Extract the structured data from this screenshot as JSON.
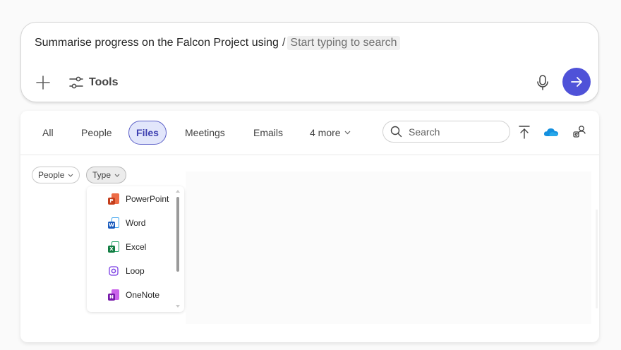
{
  "compose": {
    "prompt_text": "Summarise progress on the Falcon Project using",
    "slash": "/",
    "search_placeholder": "Start typing to search",
    "tools_label": "Tools",
    "icons": {
      "add": "plus-icon",
      "tools": "sliders-icon",
      "mic": "microphone-icon",
      "send": "arrow-right-icon"
    },
    "send_color": "#4f52d8"
  },
  "panel": {
    "tabs": [
      {
        "label": "All"
      },
      {
        "label": "People"
      },
      {
        "label": "Files",
        "active": true
      },
      {
        "label": "Meetings"
      },
      {
        "label": "Emails"
      },
      {
        "label": "4 more"
      }
    ],
    "search": {
      "placeholder": "Search"
    },
    "actions": [
      "upload-icon",
      "onedrive-icon",
      "people-settings-icon"
    ],
    "filters": [
      {
        "label": "People"
      },
      {
        "label": "Type",
        "open": true
      }
    ],
    "type_options": [
      {
        "label": "PowerPoint",
        "icon": "powerpoint-icon",
        "color": "#c43e1c",
        "letter": "P"
      },
      {
        "label": "Word",
        "icon": "word-icon",
        "color": "#185abd",
        "letter": "W"
      },
      {
        "label": "Excel",
        "icon": "excel-icon",
        "color": "#107c41",
        "letter": "X"
      },
      {
        "label": "Loop",
        "icon": "loop-icon",
        "color": "#7b3fe4",
        "letter": ""
      },
      {
        "label": "OneNote",
        "icon": "onenote-icon",
        "color": "#7719aa",
        "letter": "N"
      }
    ],
    "accent": "#5b5fc7"
  }
}
